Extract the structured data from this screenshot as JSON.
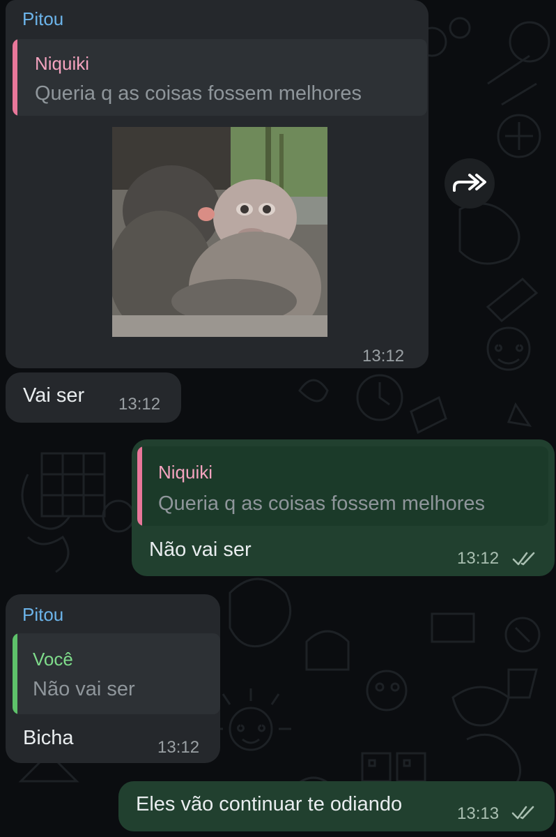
{
  "messages": [
    {
      "sender": "Pitou",
      "reply": {
        "name": "Niquiki",
        "text": "Queria q as coisas fossem melhores"
      },
      "media": "sticker-image",
      "time": "13:12"
    },
    {
      "text": "Vai ser",
      "time": "13:12"
    },
    {
      "reply": {
        "name": "Niquiki",
        "text": "Queria q as coisas fossem melhores"
      },
      "text": "Não vai ser",
      "time": "13:12",
      "status": "read"
    },
    {
      "sender": "Pitou",
      "reply": {
        "name": "Você",
        "text": "Não vai ser"
      },
      "text": "Bicha",
      "time": "13:12"
    },
    {
      "text": "Eles vão continuar te odiando",
      "time": "13:13",
      "status": "read"
    }
  ],
  "icons": {
    "forward": "forward-icon",
    "read_receipt": "double-check-icon"
  },
  "colors": {
    "background": "#0b0d10",
    "incoming_bubble": "#25282c",
    "outgoing_bubble": "#21402f",
    "sender_name": "#6cb4ea",
    "reply_pink": "#e8779a",
    "reply_green": "#5ec26a"
  }
}
